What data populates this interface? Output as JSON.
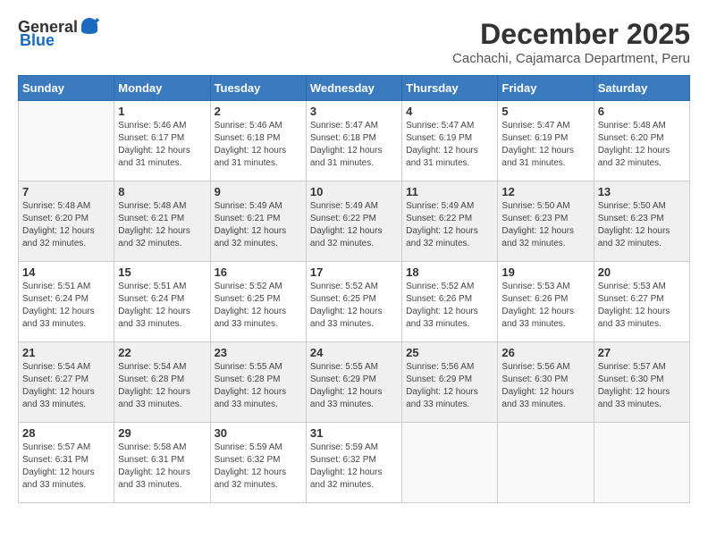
{
  "header": {
    "logo_general": "General",
    "logo_blue": "Blue",
    "month_title": "December 2025",
    "location": "Cachachi, Cajamarca Department, Peru"
  },
  "days_of_week": [
    "Sunday",
    "Monday",
    "Tuesday",
    "Wednesday",
    "Thursday",
    "Friday",
    "Saturday"
  ],
  "weeks": [
    [
      {
        "day": "",
        "info": ""
      },
      {
        "day": "1",
        "info": "Sunrise: 5:46 AM\nSunset: 6:17 PM\nDaylight: 12 hours\nand 31 minutes."
      },
      {
        "day": "2",
        "info": "Sunrise: 5:46 AM\nSunset: 6:18 PM\nDaylight: 12 hours\nand 31 minutes."
      },
      {
        "day": "3",
        "info": "Sunrise: 5:47 AM\nSunset: 6:18 PM\nDaylight: 12 hours\nand 31 minutes."
      },
      {
        "day": "4",
        "info": "Sunrise: 5:47 AM\nSunset: 6:19 PM\nDaylight: 12 hours\nand 31 minutes."
      },
      {
        "day": "5",
        "info": "Sunrise: 5:47 AM\nSunset: 6:19 PM\nDaylight: 12 hours\nand 31 minutes."
      },
      {
        "day": "6",
        "info": "Sunrise: 5:48 AM\nSunset: 6:20 PM\nDaylight: 12 hours\nand 32 minutes."
      }
    ],
    [
      {
        "day": "7",
        "info": "Sunrise: 5:48 AM\nSunset: 6:20 PM\nDaylight: 12 hours\nand 32 minutes."
      },
      {
        "day": "8",
        "info": "Sunrise: 5:48 AM\nSunset: 6:21 PM\nDaylight: 12 hours\nand 32 minutes."
      },
      {
        "day": "9",
        "info": "Sunrise: 5:49 AM\nSunset: 6:21 PM\nDaylight: 12 hours\nand 32 minutes."
      },
      {
        "day": "10",
        "info": "Sunrise: 5:49 AM\nSunset: 6:22 PM\nDaylight: 12 hours\nand 32 minutes."
      },
      {
        "day": "11",
        "info": "Sunrise: 5:49 AM\nSunset: 6:22 PM\nDaylight: 12 hours\nand 32 minutes."
      },
      {
        "day": "12",
        "info": "Sunrise: 5:50 AM\nSunset: 6:23 PM\nDaylight: 12 hours\nand 32 minutes."
      },
      {
        "day": "13",
        "info": "Sunrise: 5:50 AM\nSunset: 6:23 PM\nDaylight: 12 hours\nand 32 minutes."
      }
    ],
    [
      {
        "day": "14",
        "info": "Sunrise: 5:51 AM\nSunset: 6:24 PM\nDaylight: 12 hours\nand 33 minutes."
      },
      {
        "day": "15",
        "info": "Sunrise: 5:51 AM\nSunset: 6:24 PM\nDaylight: 12 hours\nand 33 minutes."
      },
      {
        "day": "16",
        "info": "Sunrise: 5:52 AM\nSunset: 6:25 PM\nDaylight: 12 hours\nand 33 minutes."
      },
      {
        "day": "17",
        "info": "Sunrise: 5:52 AM\nSunset: 6:25 PM\nDaylight: 12 hours\nand 33 minutes."
      },
      {
        "day": "18",
        "info": "Sunrise: 5:52 AM\nSunset: 6:26 PM\nDaylight: 12 hours\nand 33 minutes."
      },
      {
        "day": "19",
        "info": "Sunrise: 5:53 AM\nSunset: 6:26 PM\nDaylight: 12 hours\nand 33 minutes."
      },
      {
        "day": "20",
        "info": "Sunrise: 5:53 AM\nSunset: 6:27 PM\nDaylight: 12 hours\nand 33 minutes."
      }
    ],
    [
      {
        "day": "21",
        "info": "Sunrise: 5:54 AM\nSunset: 6:27 PM\nDaylight: 12 hours\nand 33 minutes."
      },
      {
        "day": "22",
        "info": "Sunrise: 5:54 AM\nSunset: 6:28 PM\nDaylight: 12 hours\nand 33 minutes."
      },
      {
        "day": "23",
        "info": "Sunrise: 5:55 AM\nSunset: 6:28 PM\nDaylight: 12 hours\nand 33 minutes."
      },
      {
        "day": "24",
        "info": "Sunrise: 5:55 AM\nSunset: 6:29 PM\nDaylight: 12 hours\nand 33 minutes."
      },
      {
        "day": "25",
        "info": "Sunrise: 5:56 AM\nSunset: 6:29 PM\nDaylight: 12 hours\nand 33 minutes."
      },
      {
        "day": "26",
        "info": "Sunrise: 5:56 AM\nSunset: 6:30 PM\nDaylight: 12 hours\nand 33 minutes."
      },
      {
        "day": "27",
        "info": "Sunrise: 5:57 AM\nSunset: 6:30 PM\nDaylight: 12 hours\nand 33 minutes."
      }
    ],
    [
      {
        "day": "28",
        "info": "Sunrise: 5:57 AM\nSunset: 6:31 PM\nDaylight: 12 hours\nand 33 minutes."
      },
      {
        "day": "29",
        "info": "Sunrise: 5:58 AM\nSunset: 6:31 PM\nDaylight: 12 hours\nand 33 minutes."
      },
      {
        "day": "30",
        "info": "Sunrise: 5:59 AM\nSunset: 6:32 PM\nDaylight: 12 hours\nand 32 minutes."
      },
      {
        "day": "31",
        "info": "Sunrise: 5:59 AM\nSunset: 6:32 PM\nDaylight: 12 hours\nand 32 minutes."
      },
      {
        "day": "",
        "info": ""
      },
      {
        "day": "",
        "info": ""
      },
      {
        "day": "",
        "info": ""
      }
    ]
  ]
}
